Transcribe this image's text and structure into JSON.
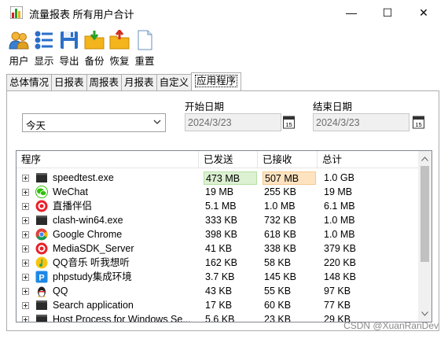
{
  "window": {
    "title": "流量报表 所有用户合计",
    "minimize_glyph": "—",
    "maximize_glyph": "☐",
    "close_glyph": "✕"
  },
  "toolbar": {
    "buttons": [
      {
        "label": "用户",
        "icon": "users-icon"
      },
      {
        "label": "显示",
        "icon": "display-settings-icon"
      },
      {
        "label": "导出",
        "icon": "save-disk-icon"
      },
      {
        "label": "备份",
        "icon": "folder-down-icon"
      },
      {
        "label": "恢复",
        "icon": "folder-up-icon"
      },
      {
        "label": "重置",
        "icon": "blank-document-icon"
      }
    ]
  },
  "tabs": [
    "总体情况",
    "日报表",
    "周报表",
    "月报表",
    "自定义",
    "应用程序"
  ],
  "active_tab": "应用程序",
  "filters": {
    "range_value": "今天",
    "start_label": "开始日期",
    "start_value": "2024/3/23",
    "end_label": "结束日期",
    "end_value": "2024/3/23",
    "calendar_day": "15"
  },
  "table": {
    "columns": [
      "程序",
      "已发送",
      "已接收",
      "总计"
    ],
    "rows": [
      {
        "name": "speedtest.exe",
        "sent": "473 MB",
        "recv": "507 MB",
        "total": "1.0 GB",
        "icon": "terminal-icon"
      },
      {
        "name": "WeChat",
        "sent": "19 MB",
        "recv": "255 KB",
        "total": "19 MB",
        "icon": "wechat-icon"
      },
      {
        "name": "直播伴侣",
        "sent": "5.1 MB",
        "recv": "1.0 MB",
        "total": "6.1 MB",
        "icon": "live-companion-icon"
      },
      {
        "name": "clash-win64.exe",
        "sent": "333 KB",
        "recv": "732 KB",
        "total": "1.0 MB",
        "icon": "terminal-icon"
      },
      {
        "name": "Google Chrome",
        "sent": "398 KB",
        "recv": "618 KB",
        "total": "1.0 MB",
        "icon": "chrome-icon"
      },
      {
        "name": "MediaSDK_Server",
        "sent": "41 KB",
        "recv": "338 KB",
        "total": "379 KB",
        "icon": "live-companion-icon"
      },
      {
        "name": "QQ音乐 听我想听",
        "sent": "162 KB",
        "recv": "58 KB",
        "total": "220 KB",
        "icon": "qq-music-icon"
      },
      {
        "name": "phpstudy集成环境",
        "sent": "3.7 KB",
        "recv": "145 KB",
        "total": "148 KB",
        "icon": "phpstudy-icon"
      },
      {
        "name": "QQ",
        "sent": "43 KB",
        "recv": "55 KB",
        "total": "97 KB",
        "icon": "qq-penguin-icon"
      },
      {
        "name": "Search application",
        "sent": "17 KB",
        "recv": "60 KB",
        "total": "77 KB",
        "icon": "terminal-icon"
      },
      {
        "name": "Host Process for Windows Se...",
        "sent": "5.6 KB",
        "recv": "23 KB",
        "total": "29 KB",
        "icon": "terminal-icon"
      }
    ]
  },
  "watermark": "CSDN @XuanRanDev",
  "colors": {
    "sent_highlight": "#dcf0d2",
    "recv_highlight": "#fde3c0",
    "toolbar_blue": "#2a6fc9",
    "folder_yellow": "#f3b41c"
  }
}
